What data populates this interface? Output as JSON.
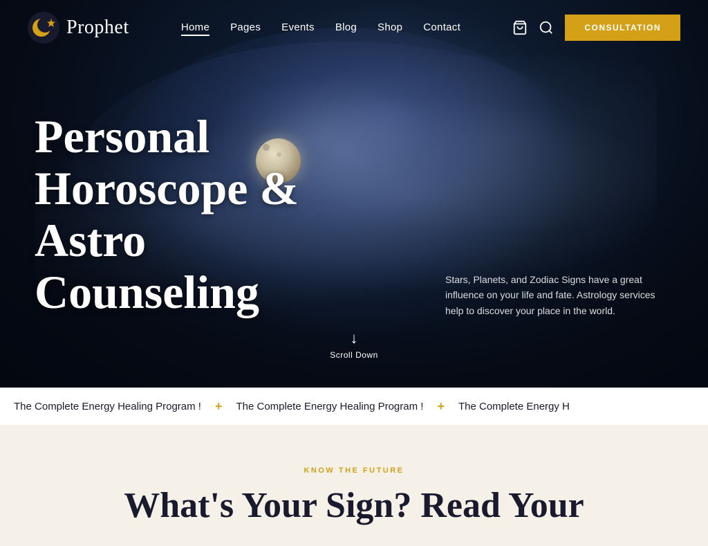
{
  "navbar": {
    "logo_text": "Prophet",
    "nav_items": [
      {
        "label": "Home",
        "active": true
      },
      {
        "label": "Pages",
        "active": false
      },
      {
        "label": "Events",
        "active": false
      },
      {
        "label": "Blog",
        "active": false
      },
      {
        "label": "Shop",
        "active": false
      },
      {
        "label": "Contact",
        "active": false
      }
    ],
    "consultation_label": "CONSULTATION",
    "cart_icon": "🛒",
    "search_icon": "🔍"
  },
  "hero": {
    "headline": "Personal Horoscope & Astro Counseling",
    "description": "Stars, Planets, and Zodiac Signs have a great influence on your life and fate. Astrology services help to discover your place in the world.",
    "scroll_label": "Scroll Down"
  },
  "ticker": {
    "items": [
      "The Complete Energy Healing Program !",
      "The Complete Energy Healing Program !",
      "The Complete Energy H"
    ]
  },
  "below_fold": {
    "know_label": "KNOW THE FUTURE",
    "headline": "What's Your Sign? Read Your"
  },
  "colors": {
    "gold": "#D4A017",
    "dark_bg": "#0d1a2e",
    "cream_bg": "#f5f0e8"
  }
}
